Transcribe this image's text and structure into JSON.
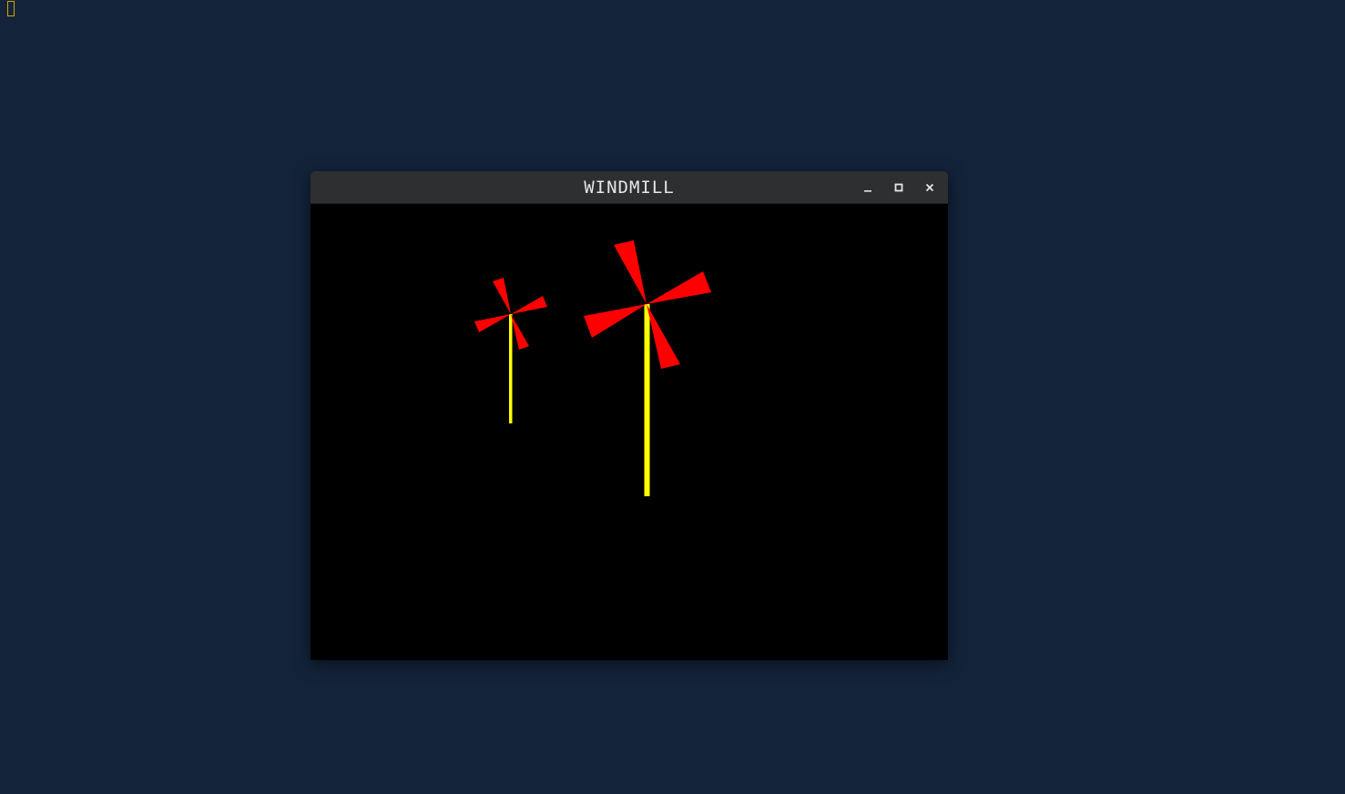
{
  "window": {
    "title": "WINDMILL",
    "controls": {
      "minimize_icon": "minimize-icon",
      "maximize_icon": "maximize-icon",
      "close_icon": "close-icon"
    }
  },
  "scene": {
    "background_color": "#000000",
    "blade_color": "#ff0000",
    "pole_color": "#ffff00"
  },
  "desktop": {
    "background_color": "#13233a",
    "indicator_color": "#d9a300"
  }
}
